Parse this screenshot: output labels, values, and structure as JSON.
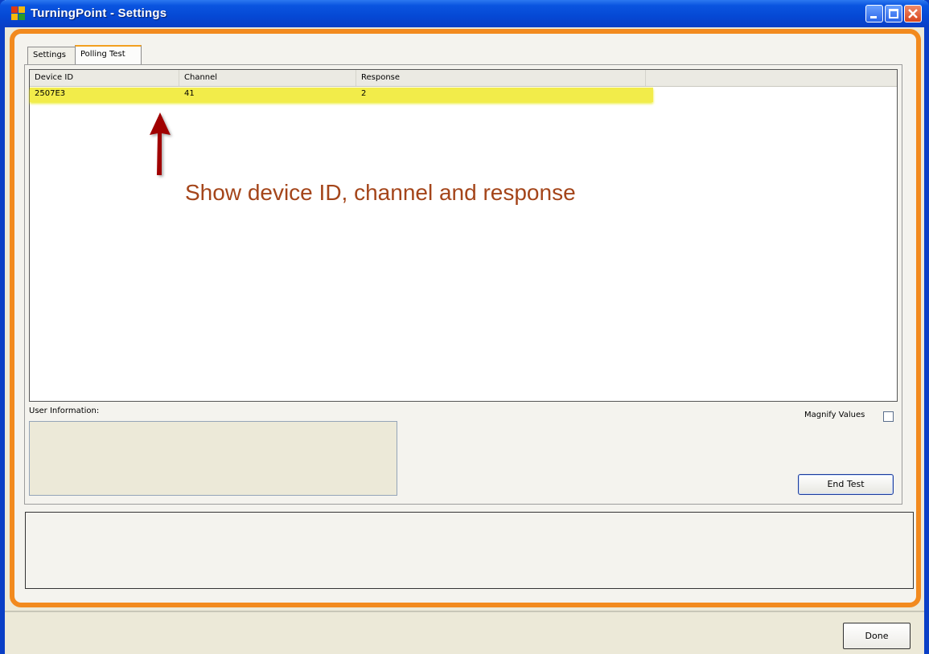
{
  "window": {
    "title": "TurningPoint - Settings"
  },
  "tabs": [
    {
      "label": "Settings",
      "active": false
    },
    {
      "label": "Polling Test",
      "active": true
    }
  ],
  "list": {
    "columns": [
      "Device ID",
      "Channel",
      "Response"
    ],
    "rows": [
      {
        "device_id": "2507E3",
        "channel": "41",
        "response": "2"
      }
    ]
  },
  "annotation": {
    "text": "Show device ID, channel and response",
    "color": "#a4451a",
    "arrow_color": "#a00000",
    "highlight_color": "#f2ec4a"
  },
  "user_info": {
    "label": "User Information:"
  },
  "magnify": {
    "label": "Magnify Values",
    "checked": false
  },
  "buttons": {
    "end_test": "End Test",
    "done": "Done"
  },
  "colors": {
    "titlebar": "#0548d4",
    "frame_accent": "#f28a1e"
  }
}
